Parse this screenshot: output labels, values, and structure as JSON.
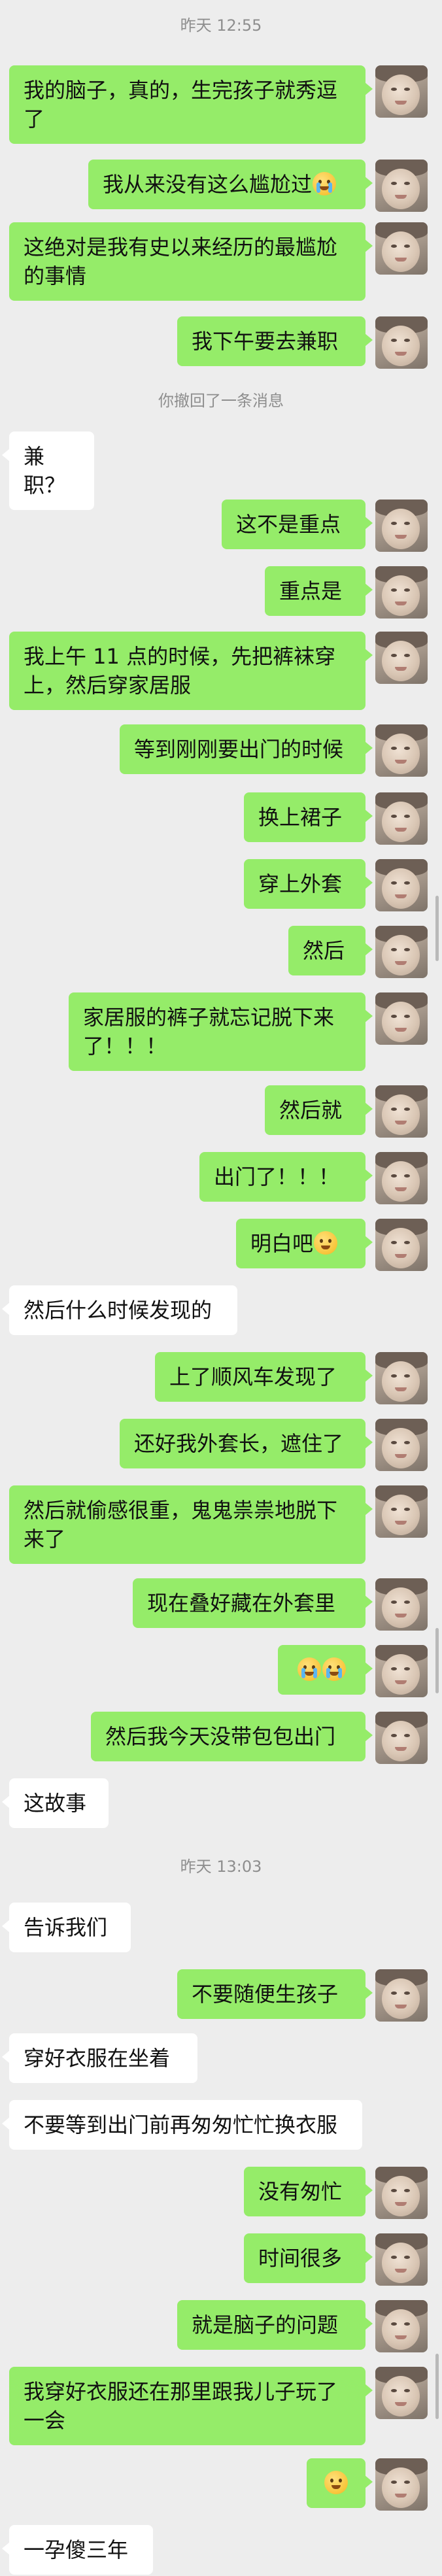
{
  "chat": {
    "timestamps": [
      "昨天 12:55",
      "昨天 13:03"
    ],
    "recall_notice": "你撤回了一条消息",
    "messages": [
      {
        "side": "me",
        "text": "我的脑子，真的，生完孩子就秀逗了",
        "emoji": null
      },
      {
        "side": "me",
        "text": "我从来没有这么尴尬过",
        "emoji": "crying-emoji"
      },
      {
        "side": "me",
        "text": "这绝对是我有史以来经历的最尴尬的事情",
        "emoji": null
      },
      {
        "side": "me",
        "text": "我下午要去兼职",
        "emoji": null
      },
      {
        "side": "other",
        "text": "兼职？",
        "emoji": null
      },
      {
        "side": "me",
        "text": "这不是重点",
        "emoji": null
      },
      {
        "side": "me",
        "text": "重点是",
        "emoji": null
      },
      {
        "side": "me",
        "text": "我上午 11 点的时候，先把裤袜穿上，然后穿家居服",
        "emoji": null
      },
      {
        "side": "me",
        "text": "等到刚刚要出门的时候",
        "emoji": null
      },
      {
        "side": "me",
        "text": "换上裙子",
        "emoji": null
      },
      {
        "side": "me",
        "text": "穿上外套",
        "emoji": null
      },
      {
        "side": "me",
        "text": "然后",
        "emoji": null
      },
      {
        "side": "me",
        "text": "家居服的裤子就忘记脱下来了！！！",
        "emoji": null
      },
      {
        "side": "me",
        "text": "然后就",
        "emoji": null
      },
      {
        "side": "me",
        "text": "出门了！！！",
        "emoji": null
      },
      {
        "side": "me",
        "text": "明白吧",
        "emoji": "grimace-emoji"
      },
      {
        "side": "other",
        "text": "然后什么时候发现的",
        "emoji": null
      },
      {
        "side": "me",
        "text": "上了顺风车发现了",
        "emoji": null
      },
      {
        "side": "me",
        "text": "还好我外套长，遮住了",
        "emoji": null
      },
      {
        "side": "me",
        "text": "然后就偷感很重，鬼鬼祟祟地脱下来了",
        "emoji": null
      },
      {
        "side": "me",
        "text": "现在叠好藏在外套里",
        "emoji": null
      },
      {
        "side": "me",
        "text": "",
        "emoji": "crying-emoji-pair"
      },
      {
        "side": "me",
        "text": "然后我今天没带包包出门",
        "emoji": null
      },
      {
        "side": "other",
        "text": "这故事",
        "emoji": null
      },
      {
        "side": "other",
        "text": "告诉我们",
        "emoji": null
      },
      {
        "side": "me",
        "text": "不要随便生孩子",
        "emoji": null
      },
      {
        "side": "other",
        "text": "穿好衣服在坐着",
        "emoji": null
      },
      {
        "side": "other",
        "text": "不要等到出门前再匆匆忙忙换衣服",
        "emoji": null
      },
      {
        "side": "me",
        "text": "没有匆忙",
        "emoji": null
      },
      {
        "side": "me",
        "text": "时间很多",
        "emoji": null
      },
      {
        "side": "me",
        "text": "就是脑子的问题",
        "emoji": null
      },
      {
        "side": "me",
        "text": "我穿好衣服还在那里跟我儿子玩了一会",
        "emoji": null
      },
      {
        "side": "me",
        "text": "",
        "emoji": "grimace-emoji"
      },
      {
        "side": "other",
        "text": "一孕傻三年",
        "emoji": null
      }
    ]
  },
  "colors": {
    "my_bubble": "#95ec69",
    "other_bubble": "#ffffff",
    "background": "#ededed",
    "timestamp": "#8e8e8e"
  }
}
